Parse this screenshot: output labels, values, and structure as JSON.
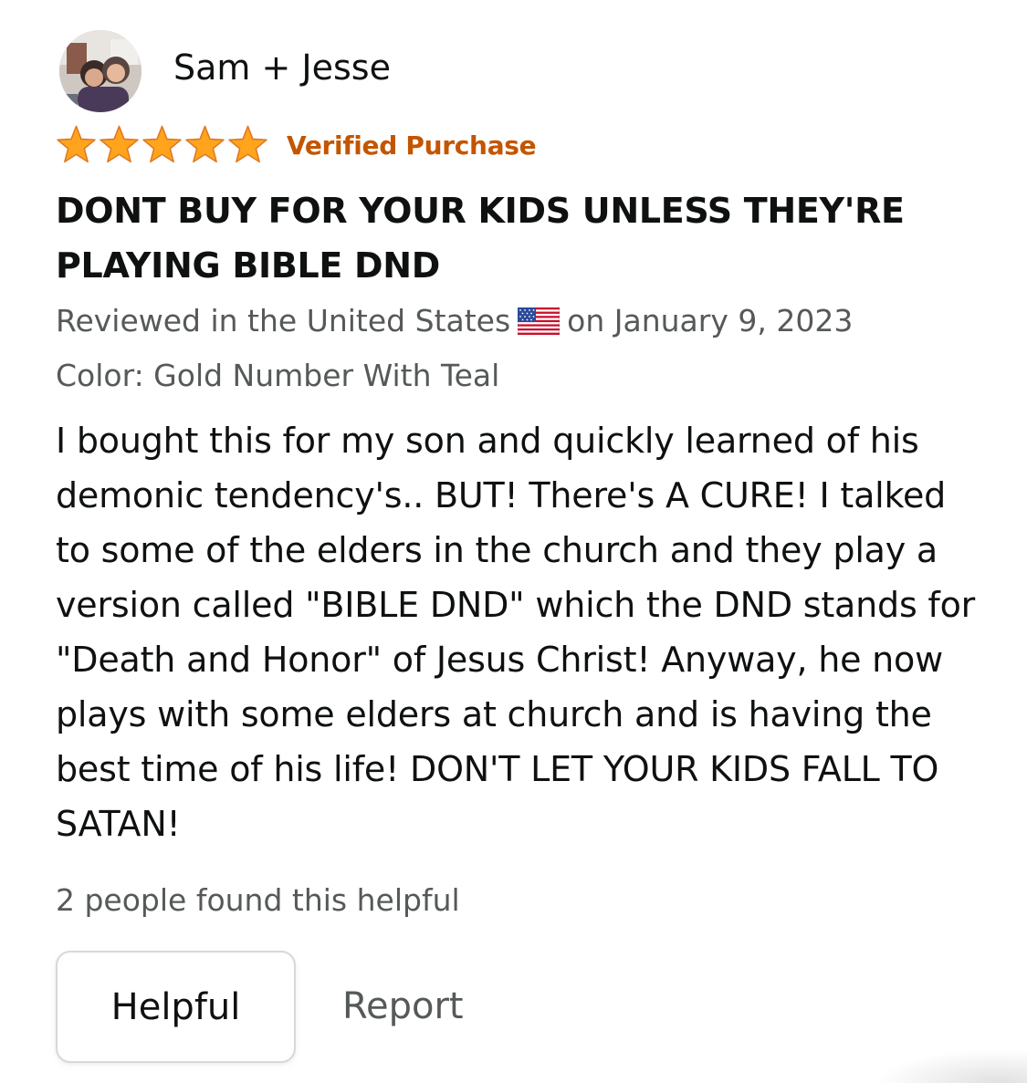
{
  "review": {
    "author_name": "Sam + Jesse",
    "rating": 5,
    "rating_max": 5,
    "verified_label": "Verified Purchase",
    "title": "DONT BUY FOR YOUR KIDS UNLESS THEY'RE PLAYING BIBLE DND",
    "reviewed_prefix": "Reviewed in the United States",
    "reviewed_suffix": "on January 9, 2023",
    "color_label": "Color: Gold Number With Teal",
    "body": "I bought this for my son and quickly learned of his demonic tendency's.. BUT! There's A CURE! I talked to some of the elders in the church and they play a version called \"BIBLE DND\" which the DND stands for \"Death and Honor\" of Jesus Christ! Anyway, he now plays with some elders at church and is having the best time of his life! DON'T LET YOUR KIDS FALL TO SATAN!",
    "helpful_count_text": "2 people found this helpful"
  },
  "actions": {
    "helpful_label": "Helpful",
    "report_label": "Report"
  },
  "icons": {
    "star": "star-icon",
    "flag": "us-flag-icon",
    "avatar": "user-avatar"
  },
  "colors": {
    "star": "#ffa41c",
    "star_outline": "#de7921",
    "verified": "#c45500",
    "text": "#0f1111",
    "secondary_text": "#565959",
    "button_border": "#d5d9d9"
  }
}
